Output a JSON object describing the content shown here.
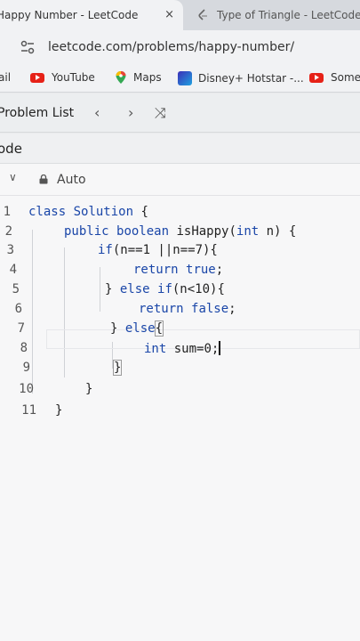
{
  "tabs": [
    {
      "title": "Happy Number - LeetCode",
      "close": "×"
    },
    {
      "title": "Type of Triangle - LeetCode"
    }
  ],
  "address": {
    "url": "leetcode.com/problems/happy-number/"
  },
  "bookmarks": [
    {
      "label": "ail",
      "icon": "none"
    },
    {
      "label": "YouTube",
      "icon": "youtube-icon"
    },
    {
      "label": "Maps",
      "icon": "maps-pin-icon"
    },
    {
      "label": "Disney+ Hotstar -...",
      "icon": "hotstar-icon"
    },
    {
      "label": "Some A",
      "icon": "youtube-icon"
    }
  ],
  "nav": {
    "problem_list": "Problem List",
    "prev": "‹",
    "next": "›",
    "shuffle": "⤨"
  },
  "panel": {
    "title": "ode",
    "mode": "Auto",
    "dropdown": "∨"
  },
  "editor": {
    "line_numbers": [
      "1",
      "2",
      "3",
      "4",
      "5",
      "6",
      "7",
      "8",
      "9",
      "10",
      "11"
    ]
  },
  "colors": {
    "keyword": "#1a46a8",
    "text": "#222222",
    "youtube": "#e62117"
  }
}
